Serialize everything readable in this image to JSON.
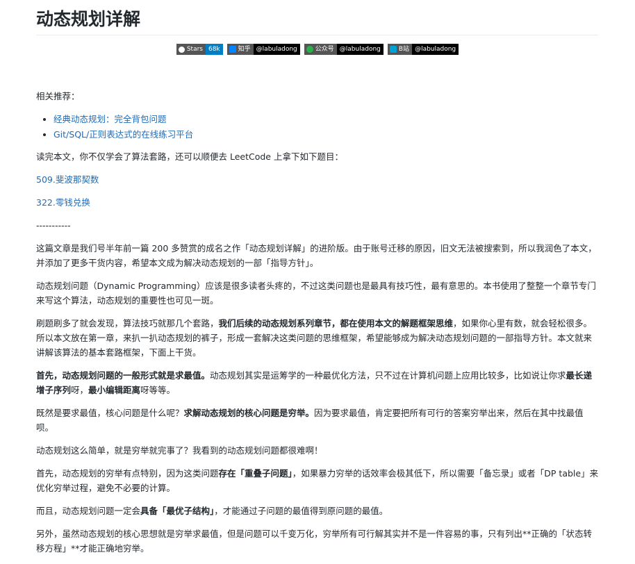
{
  "title": "动态规划详解",
  "badges": [
    {
      "label": "Stars",
      "value": "68k"
    },
    {
      "label": "知乎",
      "value": "@labuladong"
    },
    {
      "label": "公众号",
      "value": "@labuladong"
    },
    {
      "label": "B站",
      "value": "@labuladong"
    }
  ],
  "related_heading": "相关推荐：",
  "related_links": [
    "经典动态规划：完全背包问题",
    "Git/SQL/正则表达式的在线练习平台"
  ],
  "intro": "读完本文，你不仅学会了算法套路，还可以顺便去 LeetCode 上拿下如下题目：",
  "problems": [
    "509.斐波那契数",
    "322.零钱兑换"
  ],
  "divider": "-----------",
  "p1": "这篇文章是我们号半年前一篇 200 多赞赏的成名之作「动态规划详解」的进阶版。由于账号迁移的原因，旧文无法被搜索到，所以我润色了本文，并添加了更多干货内容，希望本文成为解决动态规划的一部「指导方针」。",
  "p2": "动态规划问题（Dynamic Programming）应该是很多读者头疼的，不过这类问题也是最具有技巧性，最有意思的。本书使用了整整一个章节专门来写这个算法，动态规划的重要性也可见一斑。",
  "p3": {
    "a": "刷题刷多了就会发现，算法技巧就那几个套路，",
    "b": "我们后续的动态规划系列章节，都在使用本文的解题框架思维",
    "c": "，如果你心里有数，就会轻松很多。所以本文放在第一章，来扒一扒动态规划的裤子，形成一套解决这类问题的思维框架，希望能够成为解决动态规划问题的一部指导方针。本文就来讲解该算法的基本套路框架，下面上干货。"
  },
  "p4": {
    "a": "首先，动态规划问题的一般形式就是求最值。",
    "b": "动态规划其实是运筹学的一种最优化方法，只不过在计算机问题上应用比较多，比如说让你求",
    "c": "最长递增子序列",
    "d": "呀，",
    "e": "最小编辑距离",
    "f": "呀等等。"
  },
  "p5": {
    "a": "既然是要求最值，核心问题是什么呢？",
    "b": "求解动态规划的核心问题是穷举。",
    "c": "因为要求最值，肯定要把所有可行的答案穷举出来，然后在其中找最值呗。"
  },
  "p6": "动态规划这么简单，就是穷举就完事了？我看到的动态规划问题都很难啊！",
  "p7": {
    "a": "首先，动态规划的穷举有点特别，因为这类问题",
    "b": "存在「重叠子问题」",
    "c": "，如果暴力穷举的话效率会极其低下，所以需要「备忘录」或者「DP table」来优化穷举过程，避免不必要的计算。"
  },
  "p8": {
    "a": "而且，动态规划问题一定会",
    "b": "具备「最优子结构」",
    "c": "，才能通过子问题的最值得到原问题的最值。"
  },
  "p9": "另外，虽然动态规划的核心思想就是穷举求最值，但是问题可以千变万化，穷举所有可行解其实并不是一件容易的事，只有列出**正确的「状态转移方程」**才能正确地穷举。"
}
